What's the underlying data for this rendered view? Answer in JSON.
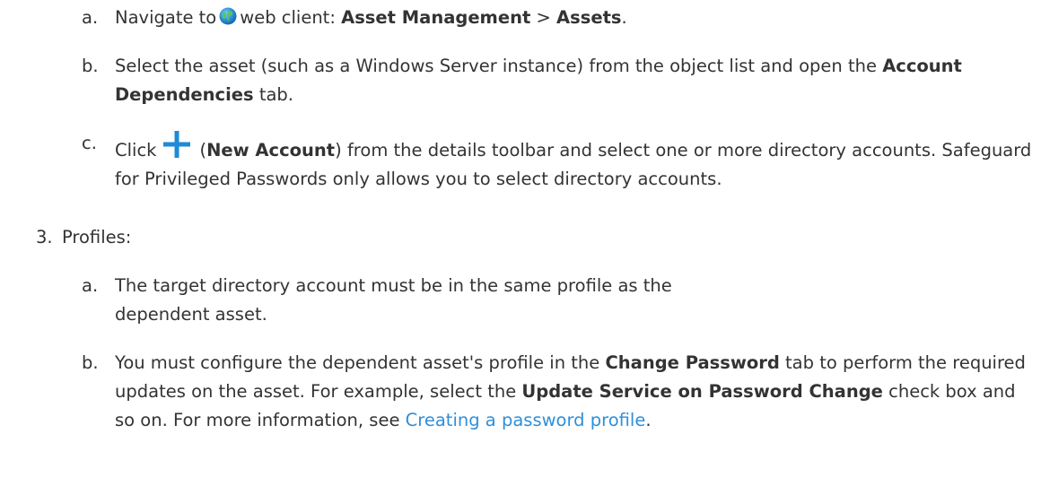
{
  "steps": {
    "a1": {
      "marker": "a.",
      "pre": "Navigate to",
      "mid": "web client:",
      "bold1": "Asset Management",
      "sep": ">",
      "bold2": "Assets",
      "post": "."
    },
    "b1": {
      "marker": "b.",
      "pre": "Select the asset (such as a Windows Server instance) from the object list and open the",
      "bold": "Account Dependencies",
      "post": "tab."
    },
    "c1": {
      "marker": "c.",
      "pre": "Click",
      "bold": "New Account",
      "post": "from the details toolbar and select one or more directory accounts. Safeguard for Privileged Passwords only allows you to select directory accounts."
    },
    "three": {
      "marker": "3.",
      "label": "Profiles:"
    },
    "a2": {
      "marker": "a.",
      "text": "The target directory account must be in the same profile as the dependent asset."
    },
    "b2": {
      "marker": "b.",
      "pre": "You must configure the dependent asset's profile in the",
      "bold1": "Change Password",
      "mid": "tab to perform the required updates on the asset. For example, select the",
      "bold2": "Update Service on Password Change",
      "post": "check box and so on. For more information, see",
      "link": "Creating a password profile",
      "end": "."
    }
  },
  "icons": {
    "globe": "globe-icon",
    "plus": "plus-icon",
    "plus_color": "#1e8bd6"
  }
}
